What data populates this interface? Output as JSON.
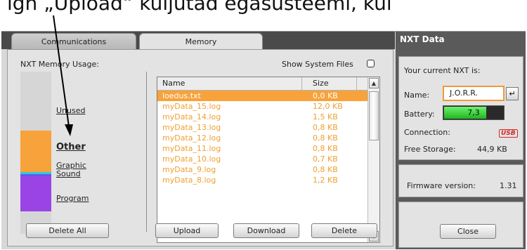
{
  "caption": "ign „Upload“ kuljutad egasüsteemi, kui",
  "tabs": [
    {
      "label": "Communications",
      "active": false
    },
    {
      "label": "Memory",
      "active": true
    }
  ],
  "memory": {
    "usage_label": "NXT Memory Usage:",
    "show_system_files_label": "Show System Files",
    "show_system_files_checked": false,
    "segments": [
      {
        "label": "Unused",
        "fraction": 0.365,
        "color": "#d6d6d6"
      },
      {
        "label": "Other",
        "fraction": 0.255,
        "color": "#f7a23a"
      },
      {
        "label": "Graphic",
        "fraction": 0.015,
        "color": "#39c4e0"
      },
      {
        "label": "Sound",
        "fraction": 0.015,
        "color": "#5b5be6"
      },
      {
        "label": "Program",
        "fraction": 0.215,
        "color": "#9a44e6"
      }
    ],
    "delete_all_label": "Delete All",
    "columns": [
      "Name",
      "Size"
    ],
    "files": [
      {
        "name": "loedus.txt",
        "size": "0,0 KB",
        "selected": true
      },
      {
        "name": "myData_15.log",
        "size": "12,0 KB"
      },
      {
        "name": "myData_14.log",
        "size": "1,5 KB"
      },
      {
        "name": "myData_13.log",
        "size": "0,8 KB"
      },
      {
        "name": "myData_12.log",
        "size": "0,8 KB"
      },
      {
        "name": "myData_11.log",
        "size": "0,8 KB"
      },
      {
        "name": "myData_10.log",
        "size": "0,7 KB"
      },
      {
        "name": "myData_9.log",
        "size": "0,8 KB"
      },
      {
        "name": "myData_8.log",
        "size": "1,2 KB"
      }
    ],
    "buttons": {
      "upload": "Upload",
      "download": "Download",
      "delete": "Delete"
    }
  },
  "nxt": {
    "title": "NXT Data",
    "current_label": "Your current NXT is:",
    "name_label": "Name:",
    "name_value": "J.O.R.R.",
    "enter_glyph": "↵",
    "battery_label": "Battery:",
    "battery_value": "7,3",
    "battery_fraction": 0.72,
    "connection_label": "Connection:",
    "connection_value": "USB",
    "storage_label": "Free Storage:",
    "storage_value": "44,9 KB",
    "firmware_label": "Firmware version:",
    "firmware_value": "1.31",
    "close_label": "Close"
  },
  "colors": {
    "accent": "#f7a23a",
    "file_text": "#f0a030",
    "battery": "#2ccc2c"
  }
}
